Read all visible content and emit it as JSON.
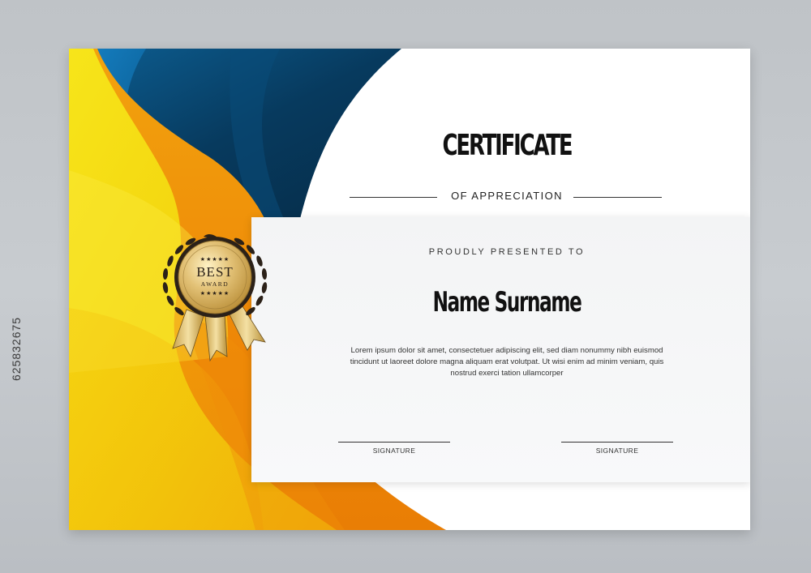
{
  "certificate": {
    "title": "CERTIFICATE",
    "subtitle": "OF APPRECIATION",
    "presented_label": "PROUDLY PRESENTED TO",
    "recipient_name": "Name Surname",
    "body_text": "Lorem ipsum dolor sit amet, consectetuer adipiscing elit, sed diam nonummy nibh euismod tincidunt ut laoreet dolore magna aliquam erat volutpat. Ut wisi enim ad minim veniam, quis nostrud exerci tation ullamcorper",
    "signatures": [
      {
        "label": "SIGNATURE"
      },
      {
        "label": "SIGNATURE"
      }
    ]
  },
  "badge": {
    "line1": "BEST",
    "line2": "AWARD",
    "stars": "★★★★★"
  },
  "stock_id": "625832675",
  "colors": {
    "navy": "#073a5e",
    "blue": "#0a6aa8",
    "yellow": "#f3d60a",
    "orange": "#ee8a07",
    "gold": "#d9b45a",
    "dark": "#2b2118"
  }
}
